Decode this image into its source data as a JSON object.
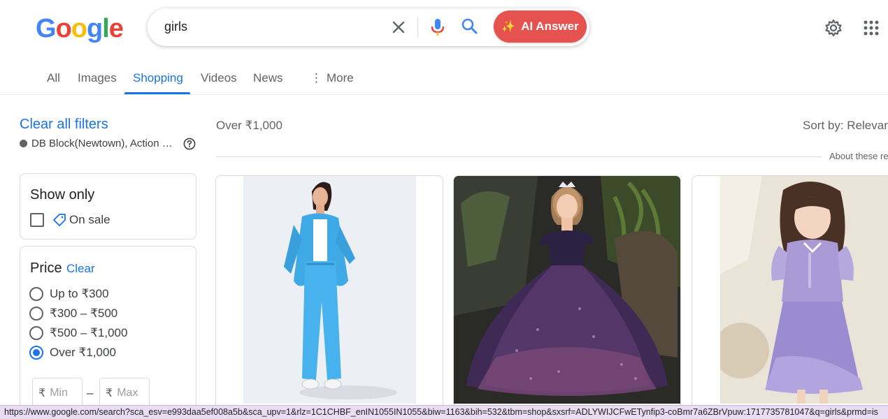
{
  "logo": {
    "letters": [
      "G",
      "o",
      "o",
      "g",
      "l",
      "e"
    ],
    "colors": [
      "#4285f4",
      "#ea4335",
      "#fbbc05",
      "#4285f4",
      "#34a853",
      "#ea4335"
    ]
  },
  "search": {
    "query": "girls",
    "ai_button_label": "AI Answer"
  },
  "tabs": [
    {
      "label": "All"
    },
    {
      "label": "Images"
    },
    {
      "label": "Shopping"
    },
    {
      "label": "Videos"
    },
    {
      "label": "News"
    },
    {
      "label": "More"
    }
  ],
  "filters": {
    "clear_all": "Clear all filters",
    "location": "DB Block(Newtown), Action …",
    "show_only": {
      "title": "Show only",
      "option": "On sale"
    },
    "price": {
      "title": "Price",
      "clear": "Clear",
      "options": [
        "Up to ₹300",
        "₹300 – ₹500",
        "₹500 – ₹1,000",
        "Over ₹1,000"
      ],
      "selected": "Over ₹1,000",
      "currency_symbol": "₹",
      "min_placeholder": "Min",
      "max_placeholder": "Max",
      "range_dash": "–"
    }
  },
  "results": {
    "active_filter": "Over ₹1,000",
    "sort_by": "Sort by: Relevan",
    "about": "About these re"
  },
  "status_url": "https://www.google.com/search?sca_esv=e993daa5ef008a5b&sca_upv=1&rlz=1C1CHBF_enIN1055IN1055&biw=1163&bih=532&tbm=shop&sxsrf=ADLYWIJCFwETynfip3-coBmr7a6ZBrVpuw:1717735781047&q=girls&prmd=is",
  "colors": {
    "accent": "#1a73e8",
    "ai_button": "#e6524f",
    "status_bar": "#eaddf3"
  }
}
